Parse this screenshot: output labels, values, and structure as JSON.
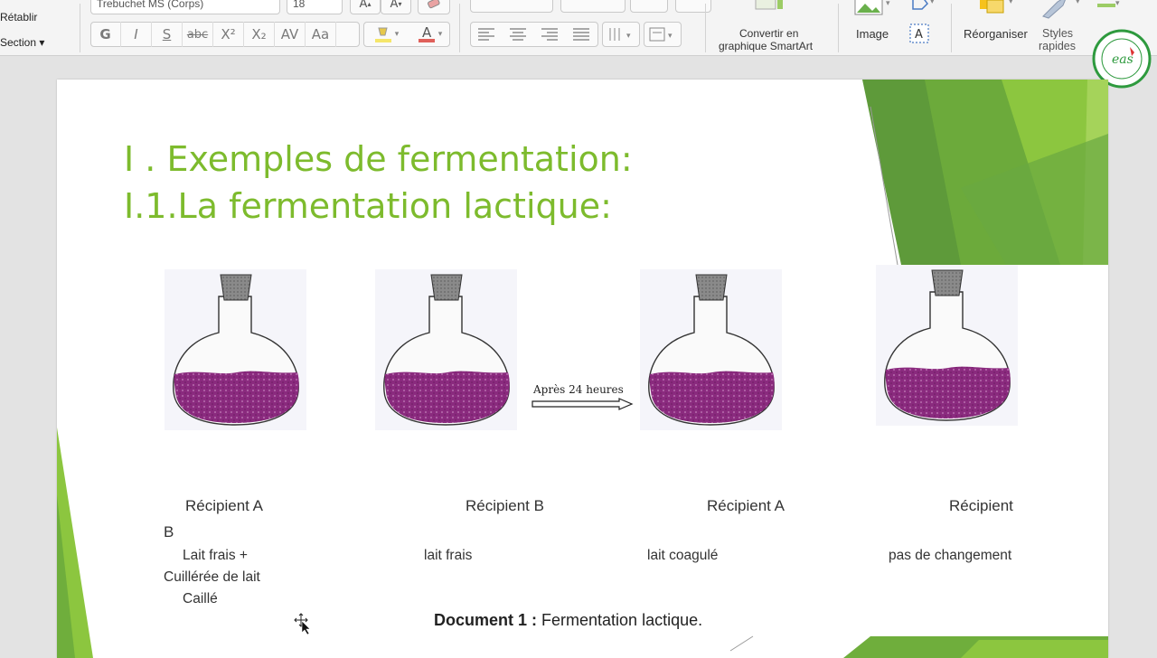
{
  "ribbon": {
    "left_items": {
      "redo": "Rétablir",
      "section": "Section ▾"
    },
    "font_name": "Trebuchet MS (Corps)",
    "font_size": "18",
    "format_buttons": [
      "G",
      "I",
      "S",
      "abc",
      "X²",
      "X₂",
      "AV",
      "Aa"
    ],
    "smartart_label_1": "Convertir en",
    "smartart_label_2": "graphique SmartArt",
    "image_label": "Image",
    "arrange_label": "Réorganiser",
    "styles_label_1": "Styles",
    "styles_label_2": "rapides",
    "accent_color": "#e0605a",
    "highlight_color": "#f5e66a"
  },
  "slide": {
    "title_line1": "I . Exemples de fermentation:",
    "title_line2": "I.1.La fermentation lactique:",
    "arrow_label": "Après 24 heures",
    "captions": [
      "Récipient A",
      "Récipient B",
      "Récipient A",
      "Récipient"
    ],
    "caption_overflow": "B",
    "contents": {
      "a1_line1": "Lait frais +",
      "a1_line2": "Cuillérée de lait",
      "a1_line3": "Caillé",
      "b1": "lait frais",
      "a2": "lait coagulé",
      "b2": "pas de changement"
    },
    "document_bold": "Document 1 :",
    "document_text": " Fermentation lactique.",
    "title_color": "#7dbb2d",
    "liquid_color": "#8a2a7e"
  }
}
